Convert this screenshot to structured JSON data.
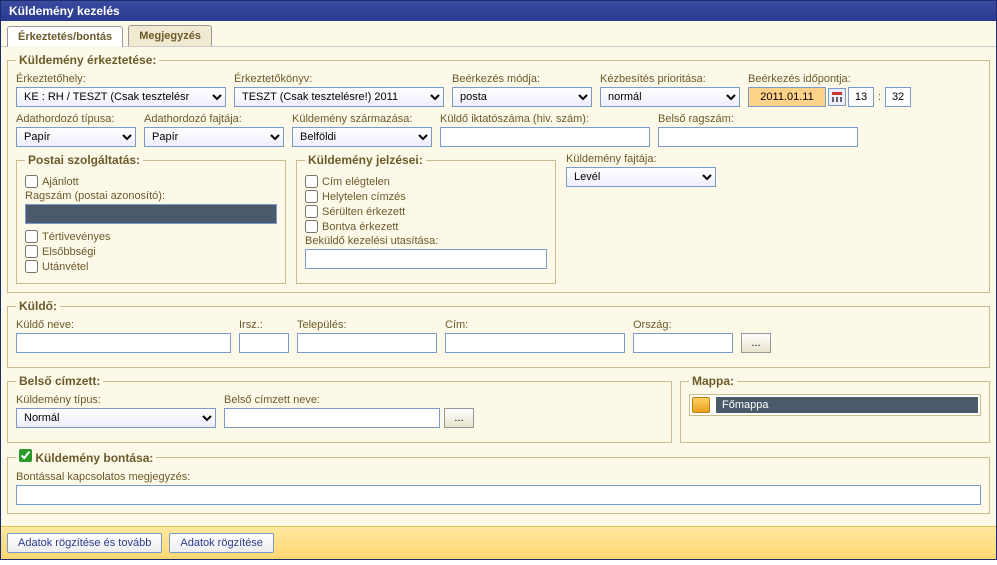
{
  "window_title": "Küldemény kezelés",
  "tabs": [
    {
      "label": "Érkeztetés/bontás",
      "active": true
    },
    {
      "label": "Megjegyzés",
      "active": false
    }
  ],
  "arrival": {
    "legend": "Küldemény érkeztetése:",
    "fields": {
      "erkeztetohely_label": "Érkeztetőhely:",
      "erkeztetohely_value": "KE : RH / TESZT (Csak tesztelésr",
      "erkeztetokonyv_label": "Érkeztetőkönyv:",
      "erkeztetokonyv_value": "TESZT (Csak tesztelésre!) 2011",
      "beerkezes_modja_label": "Beérkezés módja:",
      "beerkezes_modja_value": "posta",
      "prioritas_label": "Kézbesítés prioritása:",
      "prioritas_value": "normál",
      "idopont_label": "Beérkezés időpontja:",
      "idopont_date": "2011.01.11",
      "idopont_h": "13",
      "idopont_m": "32",
      "adathordozo_tipus_label": "Adathordozó típusa:",
      "adathordozo_tipus_value": "Papír",
      "adathordozo_fajta_label": "Adathordozó fajtája:",
      "adathordozo_fajta_value": "Papír",
      "szarmazas_label": "Küldemény származása:",
      "szarmazas_value": "Belföldi",
      "kuldo_iktatoszam_label": "Küldő iktatószáma (hiv. szám):",
      "kuldo_iktatoszam_value": "",
      "belso_ragszam_label": "Belső ragszám:",
      "belso_ragszam_value": ""
    }
  },
  "postal": {
    "legend": "Postai szolgáltatás:",
    "items": {
      "ajanlott": "Ajánlott",
      "ragszam_label": "Ragszám (postai azonosító):",
      "ragszam_value": "",
      "tertivevenyes": "Tértivevényes",
      "elsobbsegi": "Elsőbbségi",
      "utanvetel": "Utánvétel"
    }
  },
  "markings": {
    "legend": "Küldemény jelzései:",
    "items": {
      "cim_elegtelen": "Cím elégtelen",
      "helytelen_cimzes": "Helytelen címzés",
      "serulten_erkezett": "Sérülten érkezett",
      "bontva_erkezett": "Bontva érkezett",
      "utasitas_label": "Beküldő kezelési utasítása:",
      "utasitas_value": ""
    }
  },
  "kind": {
    "label": "Küldemény fajtája:",
    "value": "Levél"
  },
  "sender": {
    "legend": "Küldő:",
    "neve_label": "Küldő neve:",
    "neve_value": "",
    "irsz_label": "Irsz.:",
    "irsz_value": "",
    "telepules_label": "Település:",
    "telepules_value": "",
    "cim_label": "Cím:",
    "cim_value": "",
    "orszag_label": "Ország:",
    "orszag_value": "",
    "browse": "..."
  },
  "recipient": {
    "legend": "Belső címzett:",
    "tipus_label": "Küldemény típus:",
    "tipus_value": "Normál",
    "neve_label": "Belső címzett neve:",
    "neve_value": "",
    "browse": "..."
  },
  "folder": {
    "legend": "Mappa:",
    "value": "Főmappa"
  },
  "open": {
    "checkbox_label": "Küldemény bontása:",
    "note_label": "Bontással kapcsolatos megjegyzés:",
    "note_value": ""
  },
  "actions": {
    "save_next": "Adatok rögzítése és tovább",
    "save": "Adatok rögzítése"
  }
}
